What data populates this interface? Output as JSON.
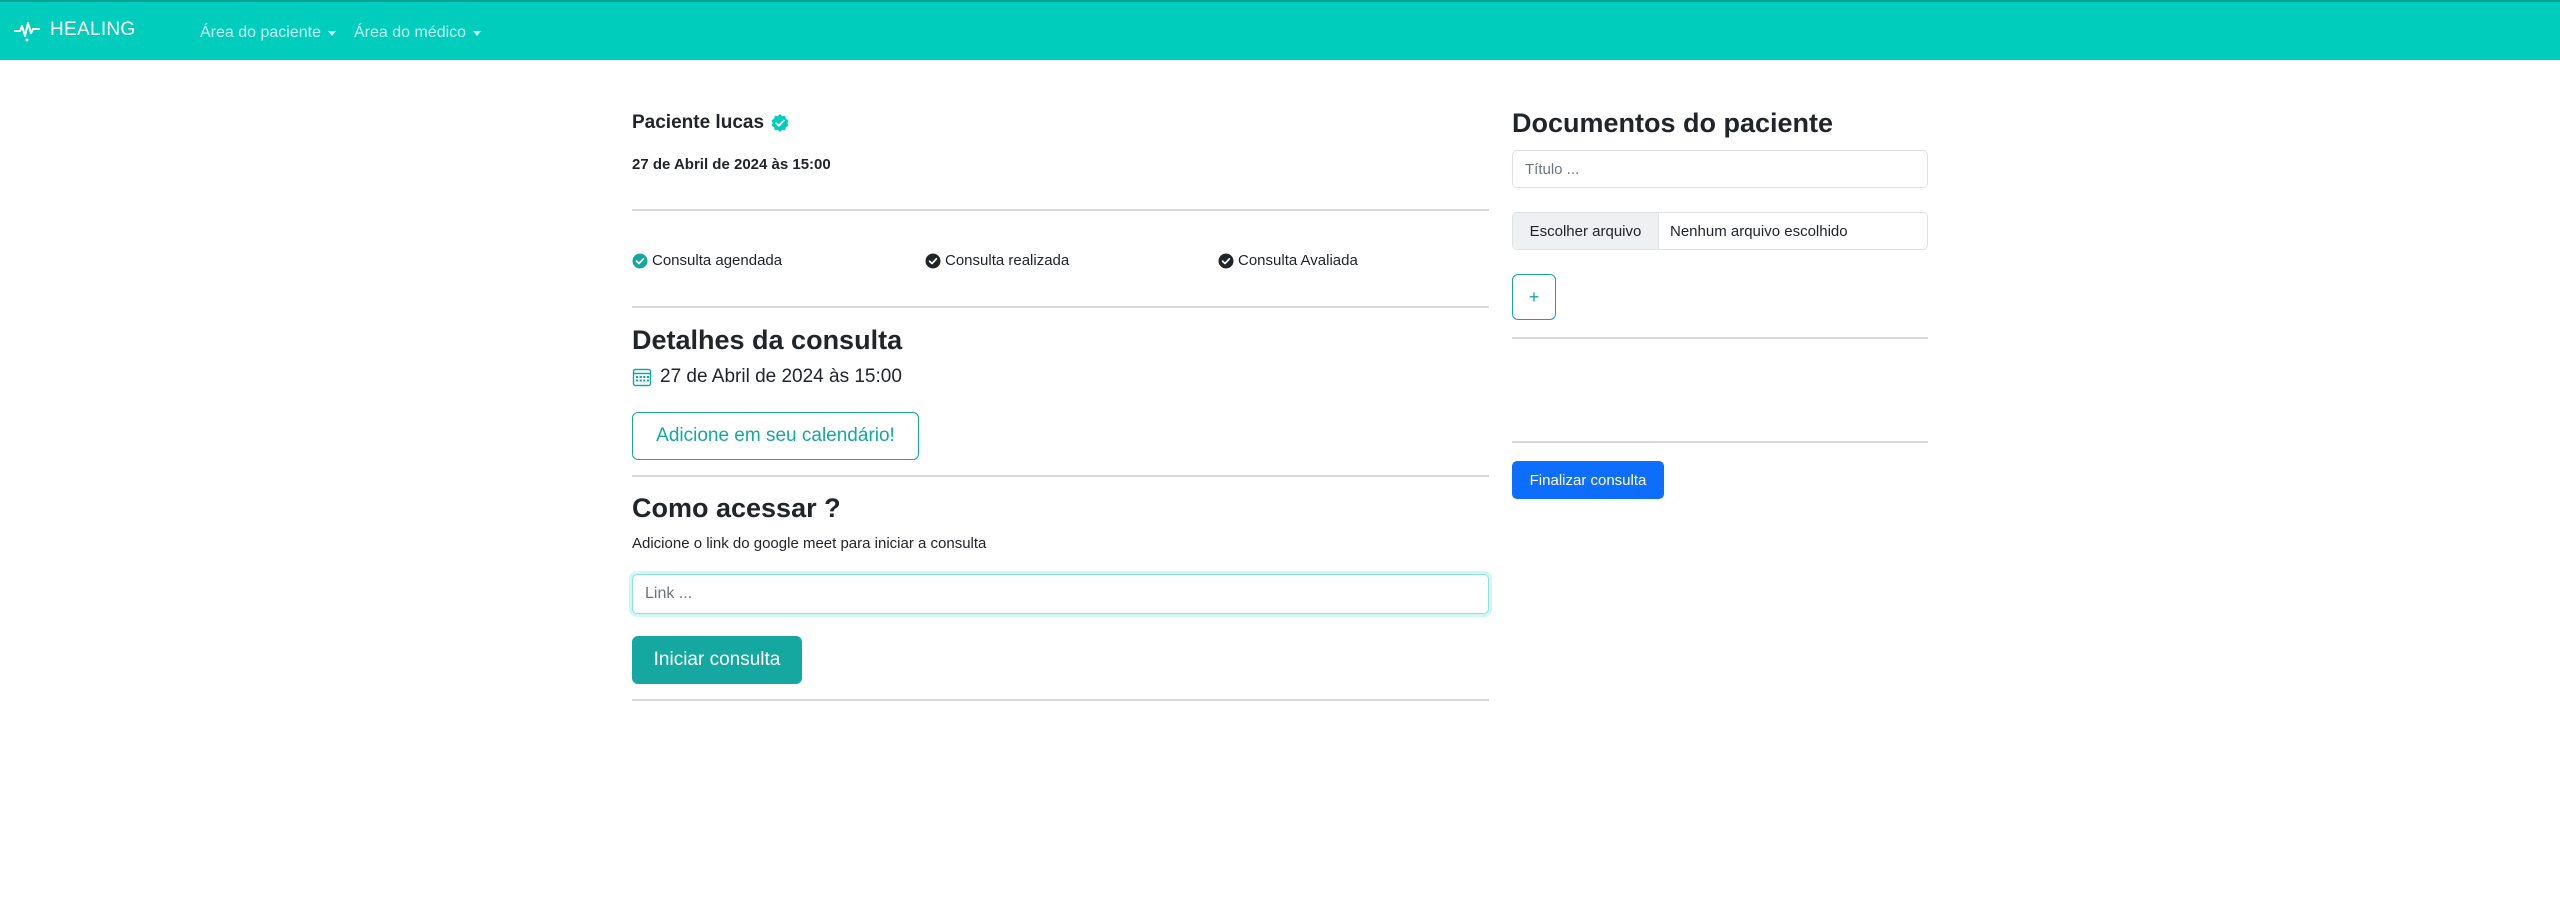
{
  "nav": {
    "brand": "HEALING",
    "items": [
      {
        "label": "Área do paciente"
      },
      {
        "label": "Área do médico"
      }
    ]
  },
  "consulta": {
    "patient_title": "Paciente lucas",
    "date_bold": "27 de Abril de 2024 às 15:00",
    "status": [
      {
        "label": "Consulta agendada",
        "color": "#14a8a0"
      },
      {
        "label": "Consulta realizada",
        "color": "#212529"
      },
      {
        "label": "Consulta Avaliada",
        "color": "#212529"
      }
    ],
    "details_heading": "Detalhes da consulta",
    "details_date": "27 de Abril de 2024 às 15:00",
    "calendar_button": "Adicione em seu calendário!",
    "access_heading": "Como acessar ?",
    "access_help": "Adicione o link do google meet para iniciar a consulta",
    "link_placeholder": "Link ...",
    "start_button": "Iniciar consulta"
  },
  "documentos": {
    "heading": "Documentos do paciente",
    "title_placeholder": "Título ...",
    "file_button": "Escolher arquivo",
    "file_status": "Nenhum arquivo escolhido",
    "add_button": "+",
    "finish_button": "Finalizar consulta"
  },
  "colors": {
    "navbar": "#00cdbb",
    "accent": "#14a8a0",
    "primary": "#0d6efd"
  }
}
